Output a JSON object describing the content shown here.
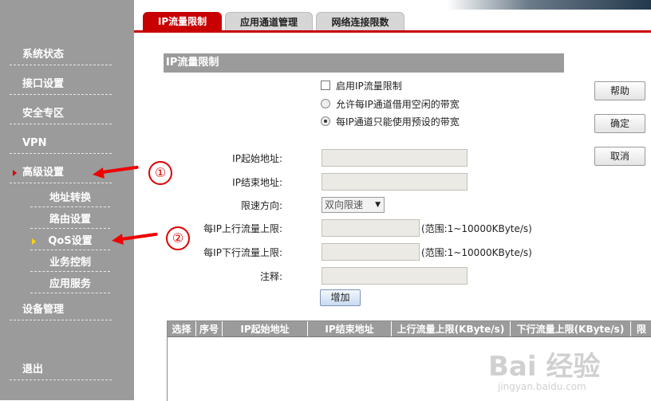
{
  "sidebar": {
    "items": [
      {
        "label": "系统状态"
      },
      {
        "label": "接口设置"
      },
      {
        "label": "安全专区"
      },
      {
        "label": "VPN"
      },
      {
        "label": "高级设置"
      },
      {
        "label": "设备管理"
      },
      {
        "label": "退出"
      }
    ],
    "subitems": [
      {
        "label": "地址转换"
      },
      {
        "label": "路由设置"
      },
      {
        "label": "QoS设置"
      },
      {
        "label": "业务控制"
      },
      {
        "label": "应用服务"
      }
    ]
  },
  "tabs": [
    {
      "label": "IP流量限制"
    },
    {
      "label": "应用通道管理"
    },
    {
      "label": "网络连接限数"
    }
  ],
  "panel": {
    "title": "IP流量限制",
    "enable_label": "启用IP流量限制",
    "radio1_label": "允许每IP通道借用空闲的带宽",
    "radio2_label": "每IP通道只能使用预设的带宽"
  },
  "buttons": {
    "help": "帮助",
    "ok": "确定",
    "cancel": "取消",
    "add": "增加"
  },
  "form": {
    "start_ip_label": "IP起始地址:",
    "end_ip_label": "IP结束地址:",
    "direction_label": "限速方向:",
    "direction_value": "双向限速",
    "up_label": "每IP上行流量上限:",
    "up_hint": "(范围:1~10000KByte/s)",
    "down_label": "每IP下行流量上限:",
    "down_hint": "(范围:1~10000KByte/s)",
    "note_label": "注释:"
  },
  "table": {
    "headers": [
      "选择",
      "序号",
      "IP起始地址",
      "IP结束地址",
      "上行流量上限(KByte/s)",
      "下行流量上限(KByte/s)",
      "限"
    ]
  },
  "annotations": {
    "marker1": "①",
    "marker2": "②"
  },
  "watermark": {
    "main": "Bai 经验",
    "sub": "jingyan.baidu.com"
  },
  "colors": {
    "accent_red": "#c80000",
    "sidebar_gray": "#9b9b9b"
  }
}
